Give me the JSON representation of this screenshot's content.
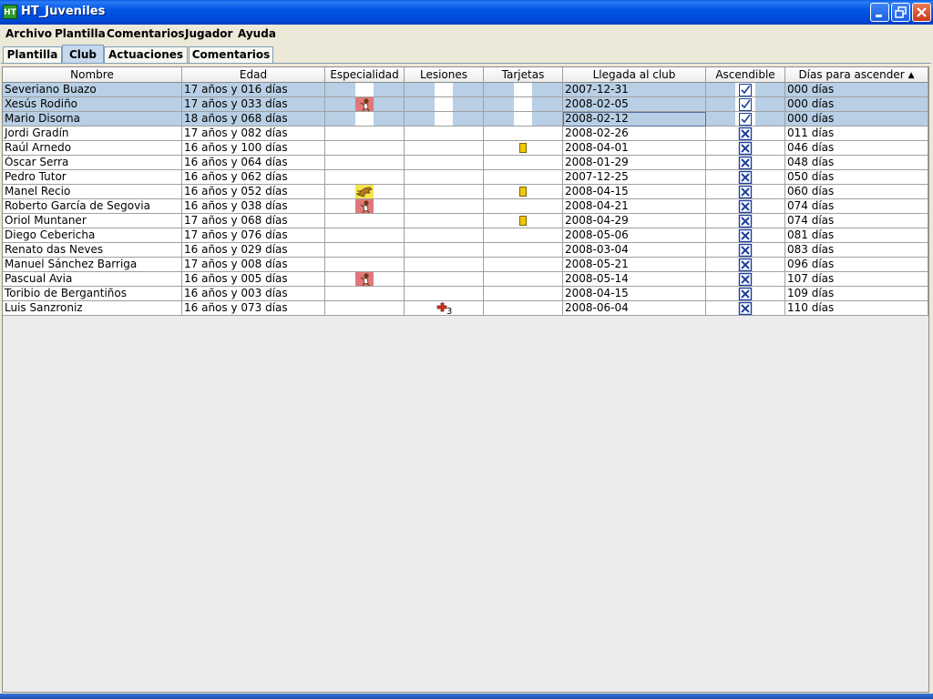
{
  "window": {
    "title": "HT_Juveniles",
    "icon_label": "HT"
  },
  "menu": [
    "Archivo",
    "Plantilla",
    "Comentarios",
    "Jugador",
    "Ayuda"
  ],
  "tabs": [
    {
      "label": "Plantilla",
      "active": false
    },
    {
      "label": "Club",
      "active": true
    },
    {
      "label": "Actuaciones",
      "active": false
    },
    {
      "label": "Comentarios",
      "active": false
    }
  ],
  "table": {
    "columns": [
      "Nombre",
      "Edad",
      "Especialidad",
      "Lesiones",
      "Tarjetas",
      "Llegada al club",
      "Ascendible",
      "Días para ascender"
    ],
    "sorted_column": "Días para ascender",
    "sort_direction": "ascending",
    "rows": [
      {
        "nombre": "Severiano Buazo",
        "edad": "17 años y 016 días",
        "especialidad": "",
        "lesion": "",
        "tarjeta": false,
        "llegada": "2007-12-31",
        "ascendible": true,
        "dias": "000 días",
        "selected": true
      },
      {
        "nombre": "Xesús Rodiño",
        "edad": "17 años y 033 días",
        "especialidad": "head",
        "lesion": "",
        "tarjeta": false,
        "llegada": "2008-02-05",
        "ascendible": true,
        "dias": "000 días",
        "selected": true
      },
      {
        "nombre": "Mario Disorna",
        "edad": "18 años y 068 días",
        "especialidad": "",
        "lesion": "",
        "tarjeta": false,
        "llegada": "2008-02-12",
        "ascendible": true,
        "dias": "000 días",
        "selected": true
      },
      {
        "nombre": "Jordi Gradín",
        "edad": "17 años y 082 días",
        "especialidad": "",
        "lesion": "",
        "tarjeta": false,
        "llegada": "2008-02-26",
        "ascendible": false,
        "dias": "011 días",
        "selected": false
      },
      {
        "nombre": "Raúl Arnedo",
        "edad": "16 años y 100 días",
        "especialidad": "",
        "lesion": "",
        "tarjeta": true,
        "llegada": "2008-04-01",
        "ascendible": false,
        "dias": "046 días",
        "selected": false
      },
      {
        "nombre": "Óscar Serra",
        "edad": "16 años y 064 días",
        "especialidad": "",
        "lesion": "",
        "tarjeta": false,
        "llegada": "2008-01-29",
        "ascendible": false,
        "dias": "048 días",
        "selected": false
      },
      {
        "nombre": "Pedro Tutor",
        "edad": "16 años y 062 días",
        "especialidad": "",
        "lesion": "",
        "tarjeta": false,
        "llegada": "2007-12-25",
        "ascendible": false,
        "dias": "050 días",
        "selected": false
      },
      {
        "nombre": "Manel Recio",
        "edad": "16 años y 052 días",
        "especialidad": "speed",
        "lesion": "",
        "tarjeta": true,
        "llegada": "2008-04-15",
        "ascendible": false,
        "dias": "060 días",
        "selected": false
      },
      {
        "nombre": "Roberto García de Segovia",
        "edad": "16 años y 038 días",
        "especialidad": "head",
        "lesion": "",
        "tarjeta": false,
        "llegada": "2008-04-21",
        "ascendible": false,
        "dias": "074 días",
        "selected": false
      },
      {
        "nombre": "Oriol Muntaner",
        "edad": "17 años y 068 días",
        "especialidad": "",
        "lesion": "",
        "tarjeta": true,
        "llegada": "2008-04-29",
        "ascendible": false,
        "dias": "074 días",
        "selected": false
      },
      {
        "nombre": "Diego Cebericha",
        "edad": "17 años y 076 días",
        "especialidad": "",
        "lesion": "",
        "tarjeta": false,
        "llegada": "2008-05-06",
        "ascendible": false,
        "dias": "081 días",
        "selected": false
      },
      {
        "nombre": "Renato das Neves",
        "edad": "16 años y 029 días",
        "especialidad": "",
        "lesion": "",
        "tarjeta": false,
        "llegada": "2008-03-04",
        "ascendible": false,
        "dias": "083 días",
        "selected": false
      },
      {
        "nombre": "Manuel Sánchez Barriga",
        "edad": "17 años y 008 días",
        "especialidad": "",
        "lesion": "",
        "tarjeta": false,
        "llegada": "2008-05-21",
        "ascendible": false,
        "dias": "096 días",
        "selected": false
      },
      {
        "nombre": "Pascual Avia",
        "edad": "16 años y 005 días",
        "especialidad": "head",
        "lesion": "",
        "tarjeta": false,
        "llegada": "2008-05-14",
        "ascendible": false,
        "dias": "107 días",
        "selected": false
      },
      {
        "nombre": "Toribio de Bergantiños",
        "edad": "16 años y 003 días",
        "especialidad": "",
        "lesion": "",
        "tarjeta": false,
        "llegada": "2008-04-15",
        "ascendible": false,
        "dias": "109 días",
        "selected": false
      },
      {
        "nombre": "Luis Sanzroniz",
        "edad": "16 años y 073 días",
        "especialidad": "",
        "lesion": "3",
        "tarjeta": false,
        "llegada": "2008-06-04",
        "ascendible": false,
        "dias": "110 días",
        "selected": false
      }
    ]
  },
  "colors": {
    "selection": "#b8cfe5",
    "card_yellow": "#f0c800",
    "injury_red": "#d03020",
    "check_blue": "#1c3f9e"
  }
}
